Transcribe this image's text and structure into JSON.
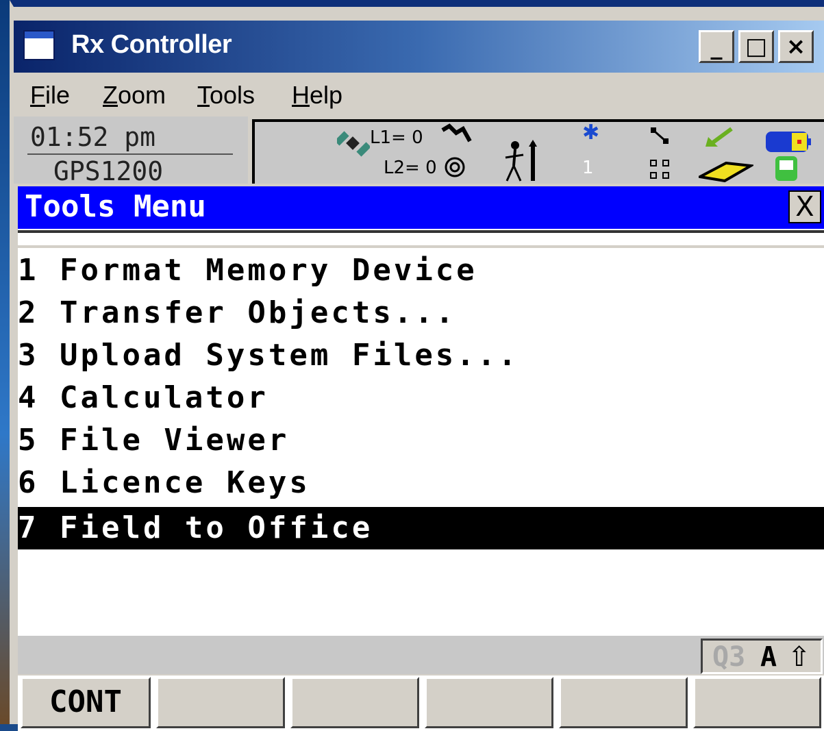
{
  "window": {
    "title": "Rx Controller",
    "controls": {
      "minimize": "_",
      "maximize": "□",
      "close": "×"
    }
  },
  "menubar": {
    "items": [
      {
        "label": "File",
        "mnemonic": "F",
        "rest": "ile"
      },
      {
        "label": "Zoom",
        "mnemonic": "Z",
        "rest": "oom"
      },
      {
        "label": "Tools",
        "mnemonic": "T",
        "rest": "ools"
      },
      {
        "label": "Help",
        "mnemonic": "H",
        "rest": "elp"
      }
    ]
  },
  "status": {
    "time": "01:52 pm",
    "model": "GPS1200",
    "l1": "L1= 0",
    "l2": "L2= 0",
    "bt_count": "1",
    "icons": [
      "satellite-icon",
      "signal-arrow-icon",
      "rtk-at-icon",
      "walking-person-icon",
      "bluetooth-icon",
      "line-connect-icon",
      "download-arrow-icon",
      "battery-icon",
      "network-icon",
      "memory-card-icon",
      "device-icon"
    ]
  },
  "panel": {
    "title": "Tools Menu",
    "close_label": "X"
  },
  "menu_items": [
    {
      "label": "1 Format Memory Device",
      "selected": false
    },
    {
      "label": "2 Transfer Objects...",
      "selected": false
    },
    {
      "label": "3 Upload System Files...",
      "selected": false
    },
    {
      "label": "4 Calculator",
      "selected": false
    },
    {
      "label": "5 File Viewer",
      "selected": false
    },
    {
      "label": "6 Licence Keys",
      "selected": false
    },
    {
      "label": "7 Field to Office",
      "selected": true
    }
  ],
  "indicators": {
    "q": "Q3",
    "mode": "A",
    "shift": "⇧"
  },
  "fkeys": [
    "CONT",
    "",
    "",
    "",
    "",
    ""
  ],
  "colors": {
    "header_blue": "#0000ff",
    "selection": "#000000",
    "title_gradient_start": "#0a246a"
  }
}
